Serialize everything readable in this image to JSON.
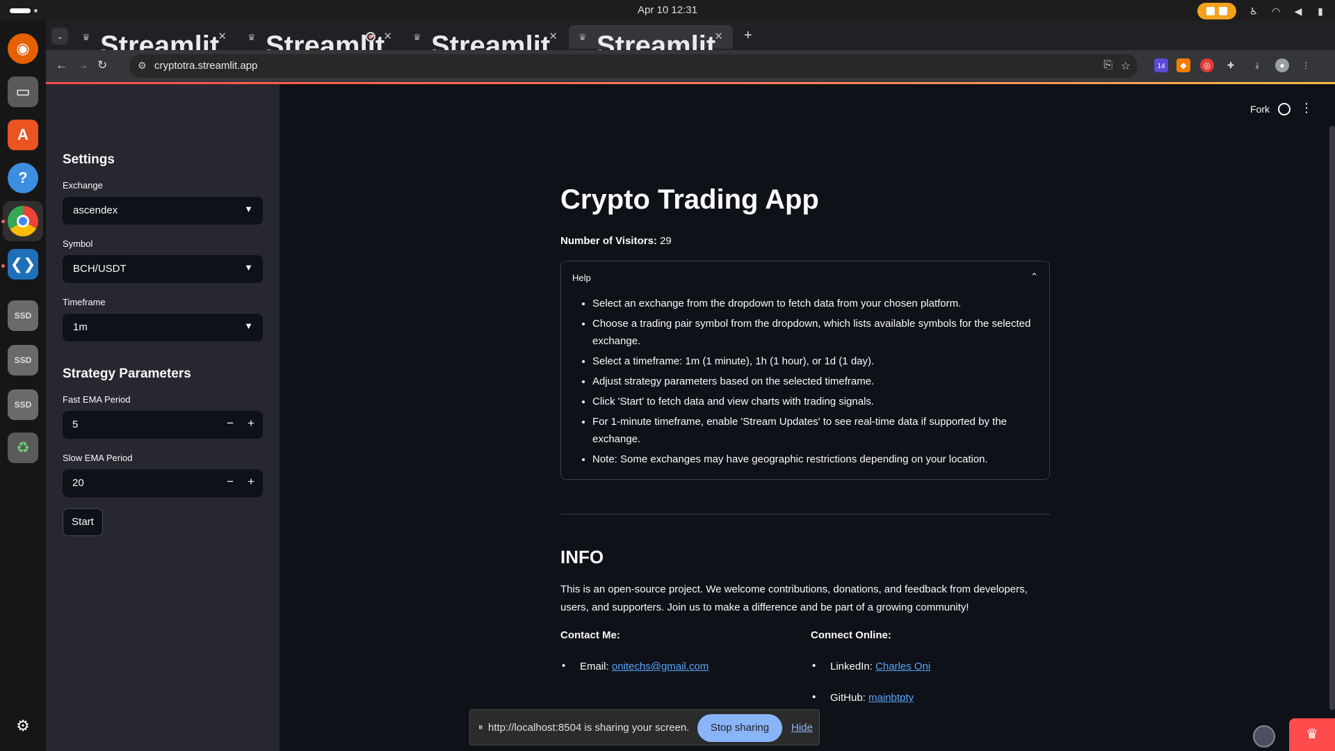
{
  "system": {
    "clock": "Apr 10  12:31"
  },
  "browser": {
    "tabs": [
      {
        "label": "Streamlit"
      },
      {
        "label": "Streamlit"
      },
      {
        "label": "Streamlit"
      },
      {
        "label": "Streamlit"
      }
    ],
    "url": "cryptotra.streamlit.app",
    "extension_badge": "14"
  },
  "app_header": {
    "fork_label": "Fork"
  },
  "sidebar": {
    "settings_heading": "Settings",
    "exchange_label": "Exchange",
    "exchange_value": "ascendex",
    "symbol_label": "Symbol",
    "symbol_value": "BCH/USDT",
    "timeframe_label": "Timeframe",
    "timeframe_value": "1m",
    "strategy_heading": "Strategy Parameters",
    "fast_ema_label": "Fast EMA Period",
    "fast_ema_value": "5",
    "slow_ema_label": "Slow EMA Period",
    "slow_ema_value": "20",
    "start_label": "Start"
  },
  "main": {
    "title": "Crypto Trading App",
    "visitors_label": "Number of Visitors:",
    "visitors_value": "29",
    "help": {
      "label": "Help",
      "items": [
        "Select an exchange from the dropdown to fetch data from your chosen platform.",
        "Choose a trading pair symbol from the dropdown, which lists available symbols for the selected exchange.",
        "Select a timeframe: 1m (1 minute), 1h (1 hour), or 1d (1 day).",
        "Adjust strategy parameters based on the selected timeframe.",
        "Click 'Start' to fetch data and view charts with trading signals.",
        "For 1-minute timeframe, enable 'Stream Updates' to see real-time data if supported by the exchange.",
        "Note: Some exchanges may have geographic restrictions depending on your location."
      ]
    },
    "info_heading": "INFO",
    "info_text": "This is an open-source project. We welcome contributions, donations, and feedback from developers, users, and supporters. Join us to make a difference and be part of a growing community!",
    "contact_heading": "Contact Me:",
    "email_label": "Email:",
    "email_value": "onitechs@gmail.com",
    "connect_heading": "Connect Online:",
    "linkedin_label": "LinkedIn:",
    "linkedin_value": "Charles Oni",
    "github_label": "GitHub:",
    "github_value": "mainbtpty"
  },
  "sharing_bar": {
    "message": "http://localhost:8504 is sharing your screen.",
    "stop_label": "Stop sharing",
    "hide_label": "Hide"
  },
  "colors": {
    "accent": "#ff4b4b",
    "link": "#58a6ff",
    "sidebar_bg": "#262730",
    "main_bg": "#0e1117"
  }
}
